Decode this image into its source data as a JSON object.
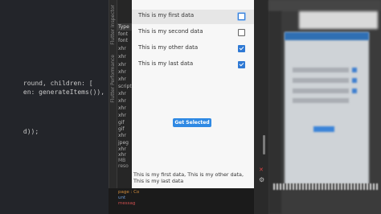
{
  "editor": {
    "lines": [
      {
        "tokens": [
          "round, children: ["
        ],
        "color": "orange"
      },
      {
        "tokens": [
          "en: generateItems()),"
        ],
        "color": "white"
      },
      {
        "tokens": [
          "d));"
        ],
        "color": "orange"
      }
    ]
  },
  "devtools": {
    "vertical_tabs": [
      "Flutter Inspector",
      "Flutter Performance"
    ],
    "network": {
      "column_header": "Type",
      "cells": [
        "font",
        "font",
        "xhr",
        "xhr",
        "xhr",
        "xhr",
        "xhr",
        "script",
        "xhr",
        "xhr",
        "xhr",
        "xhr",
        "gif",
        "gif",
        "xhr",
        "jpeg",
        "xhr",
        "xhr"
      ],
      "footer": "MB reso"
    }
  },
  "app": {
    "items": [
      {
        "label": "This is my first data",
        "checked": false,
        "focused": true
      },
      {
        "label": "This is my second data",
        "checked": false,
        "focused": false
      },
      {
        "label": "This is my other data",
        "checked": true,
        "focused": false
      },
      {
        "label": "This is my last data",
        "checked": true,
        "focused": false
      }
    ],
    "button_label": "Get Selected",
    "result_text": "This is my first data, This is my other data, This is my last data",
    "accent_color": "#2f89e3"
  },
  "console": {
    "line1": "page : Co",
    "line2": "unt",
    "line3": "messag"
  }
}
